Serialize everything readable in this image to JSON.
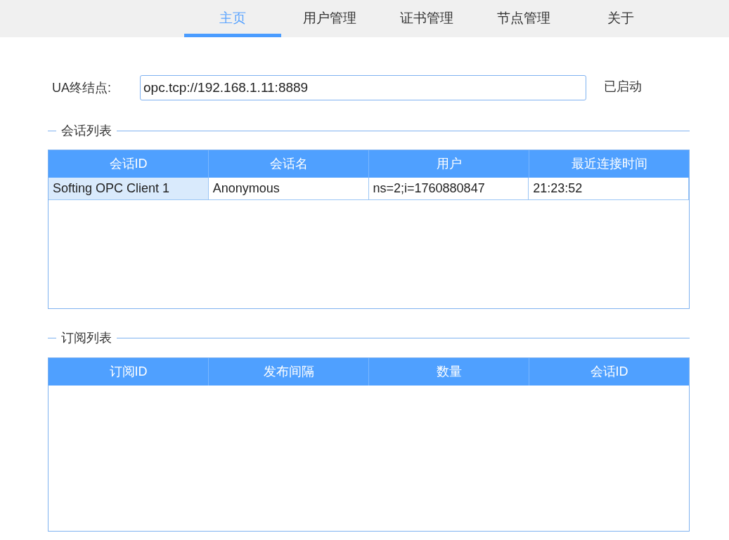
{
  "tabs": [
    {
      "label": "主页",
      "selected": true
    },
    {
      "label": "用户管理",
      "selected": false
    },
    {
      "label": "证书管理",
      "selected": false
    },
    {
      "label": "节点管理",
      "selected": false
    },
    {
      "label": "关于",
      "selected": false
    }
  ],
  "endpoint": {
    "label": "UA终结点:",
    "value": "opc.tcp://192.168.1.11:8889",
    "status": "已启动"
  },
  "groups": [
    {
      "title": "会话列表",
      "columns": [
        "会话ID",
        "会话名",
        "用户",
        "最近连接时间"
      ],
      "rows": [
        {
          "cells": [
            {
              "text": "Softing OPC Client 1",
              "selected": true
            },
            {
              "text": "Anonymous",
              "selected": false
            },
            {
              "text": "ns=2;i=1760880847",
              "selected": false
            },
            {
              "text": "21:23:52",
              "selected": false
            }
          ]
        }
      ]
    },
    {
      "title": "订阅列表",
      "columns": [
        "订阅ID",
        "发布间隔",
        "数量",
        "会话ID"
      ]
    }
  ]
}
